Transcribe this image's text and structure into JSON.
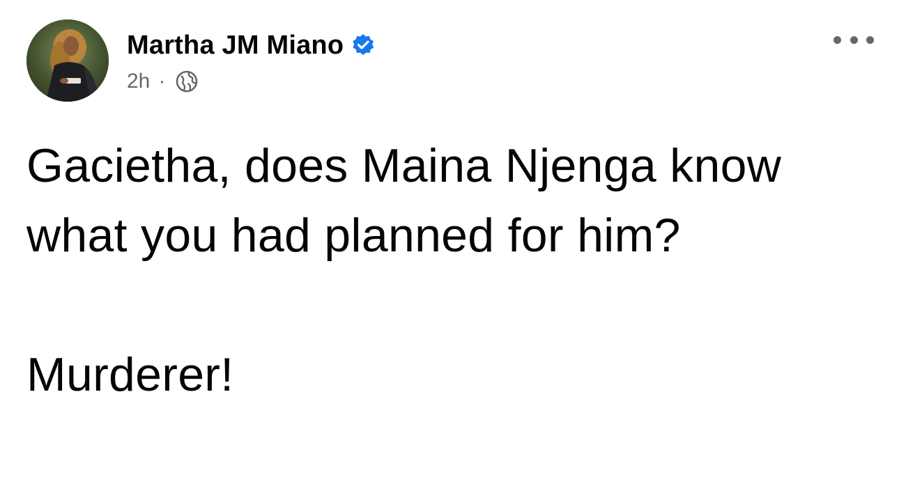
{
  "post": {
    "author": {
      "name": "Martha JM Miano",
      "verified": true,
      "avatar_icon": "profile-photo"
    },
    "timestamp": "2h",
    "separator": "·",
    "audience_icon": "globe-icon",
    "more_icon": "more-options-icon",
    "body": {
      "line1": "Gacietha, does Maina Njenga know what you had planned for him?",
      "line2": "Murderer!"
    }
  },
  "colors": {
    "text_primary": "#050505",
    "text_secondary": "#65676b",
    "verified_blue": "#1877f2",
    "background": "#ffffff"
  }
}
